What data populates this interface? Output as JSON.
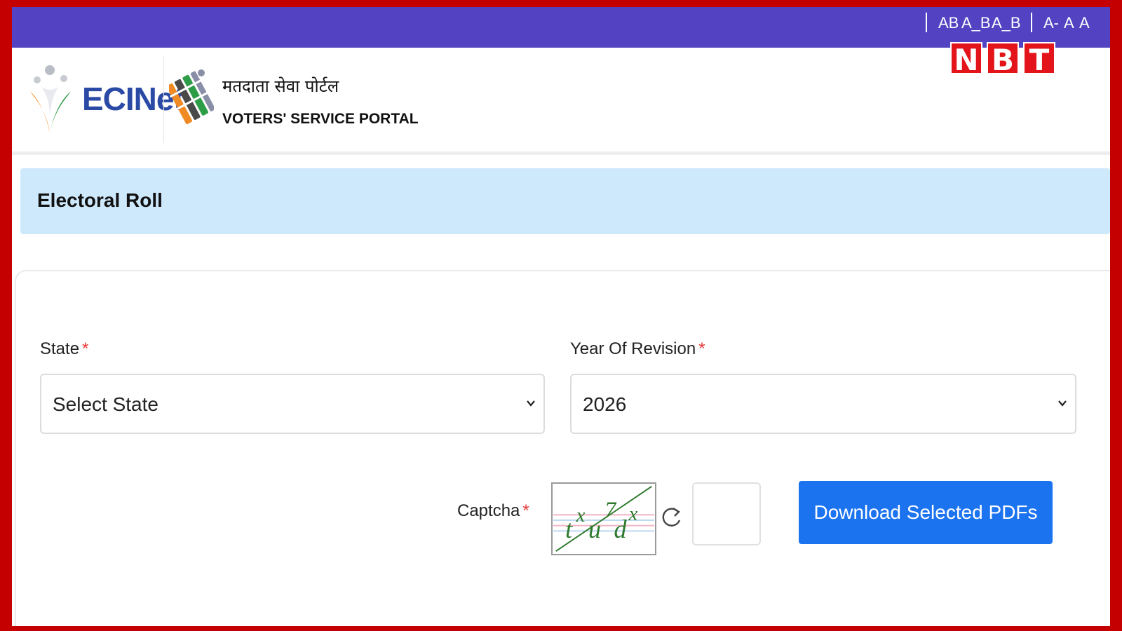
{
  "topbar": {
    "color": "#5343c2",
    "font_options": [
      "AB",
      "A_B",
      "A_B"
    ],
    "size_options": [
      "A-",
      "A",
      "A"
    ]
  },
  "watermark": {
    "letters": [
      "N",
      "B",
      "T"
    ],
    "color": "#e3151a"
  },
  "header": {
    "brand_name": "ECINet",
    "emblem_icon": "eci-emblem-icon",
    "portal_hindi": "मतदाता सेवा पोर्टल",
    "portal_english": "VOTERS' SERVICE PORTAL"
  },
  "section": {
    "title": "Electoral Roll",
    "banner_color": "#cfe9fc"
  },
  "form": {
    "state": {
      "label": "State",
      "required_mark": "*",
      "value": "Select State"
    },
    "year": {
      "label": "Year Of Revision",
      "required_mark": "*",
      "value": "2026"
    },
    "captcha": {
      "label": "Captcha",
      "required_mark": "*",
      "image_text": "txu7dx",
      "input_value": ""
    },
    "download_button": {
      "label": "Download Selected PDFs",
      "color": "#1b73f0"
    }
  },
  "accent_color": "#c40000"
}
